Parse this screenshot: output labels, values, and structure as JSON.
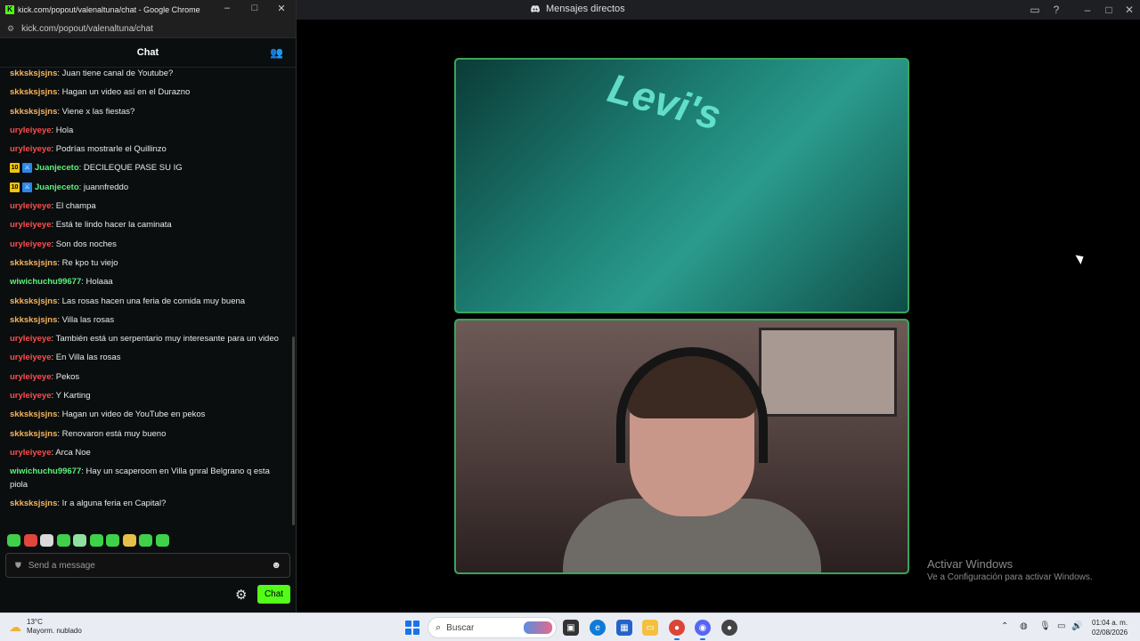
{
  "discord": {
    "title": "Mensajes directos",
    "activate_title": "Activar Windows",
    "activate_sub": "Ve a Configuración para activar Windows."
  },
  "chrome": {
    "title": "kick.com/popout/valenaltuna/chat - Google Chrome",
    "url": "kick.com/popout/valenaltuna/chat"
  },
  "chat": {
    "header": "Chat",
    "placeholder": "Send a message",
    "send_label": "Chat",
    "messages": [
      {
        "user": "skksksjsjns",
        "color": "orange",
        "text": ": Juan tiene canal de Youtube?"
      },
      {
        "user": "skksksjsjns",
        "color": "orange",
        "text": ": Hagan un video así en el Durazno"
      },
      {
        "user": "skksksjsjns",
        "color": "orange",
        "text": ": Viene x las fiestas?"
      },
      {
        "user": "uryleiyeye",
        "color": "red",
        "text": ": Hola"
      },
      {
        "user": "uryleiyeye",
        "color": "red",
        "text": ": Podrías mostrarle el Quillinzo"
      },
      {
        "user": "Juanjeceto",
        "color": "green",
        "badge": "10",
        "text": ": DECILEQUE PASE SU IG"
      },
      {
        "user": "Juanjeceto",
        "color": "green",
        "badge": "10",
        "text": ": juannfreddo"
      },
      {
        "user": "uryleiyeye",
        "color": "red",
        "text": ": El champa"
      },
      {
        "user": "uryleiyeye",
        "color": "red",
        "text": ": Está te lindo hacer la caminata"
      },
      {
        "user": "uryleiyeye",
        "color": "red",
        "text": ": Son dos noches"
      },
      {
        "user": "skksksjsjns",
        "color": "orange",
        "text": ": Re kpo tu viejo"
      },
      {
        "user": "wiwichuchu99677",
        "color": "green",
        "text": ": Holaaa"
      },
      {
        "user": "skksksjsjns",
        "color": "orange",
        "text": ": Las rosas hacen una feria de comida muy buena"
      },
      {
        "user": "skksksjsjns",
        "color": "orange",
        "text": ": Villa las rosas"
      },
      {
        "user": "uryleiyeye",
        "color": "red",
        "text": ": También está un serpentario muy interesante para un video"
      },
      {
        "user": "uryleiyeye",
        "color": "red",
        "text": ": En Villa las rosas"
      },
      {
        "user": "uryleiyeye",
        "color": "red",
        "text": ": Pekos"
      },
      {
        "user": "uryleiyeye",
        "color": "red",
        "text": ": Y Karting"
      },
      {
        "user": "skksksjsjns",
        "color": "orange",
        "text": ": Hagan un video de YouTube en pekos"
      },
      {
        "user": "skksksjsjns",
        "color": "orange",
        "text": ": Renovaron está muy bueno"
      },
      {
        "user": "uryleiyeye",
        "color": "red",
        "text": ": Arca Noe"
      },
      {
        "user": "wiwichuchu99677",
        "color": "green",
        "text": ": Hay un scaperoom en Villa gnral Belgrano q esta piola"
      },
      {
        "user": "skksksjsjns",
        "color": "orange",
        "text": ": Ir a alguna feria en Capital?"
      }
    ]
  },
  "taskbar": {
    "temp": "13°C",
    "weather": "Mayorm. nublado",
    "search_placeholder": "Buscar",
    "time": "01:04 a. m.",
    "date": "02/08/2026"
  },
  "colors": {
    "kick_green": "#53fc18",
    "orange": "#f5b45b",
    "red": "#ff4d4d",
    "green": "#5cf07b",
    "speaking_border": "#3ba55c"
  }
}
